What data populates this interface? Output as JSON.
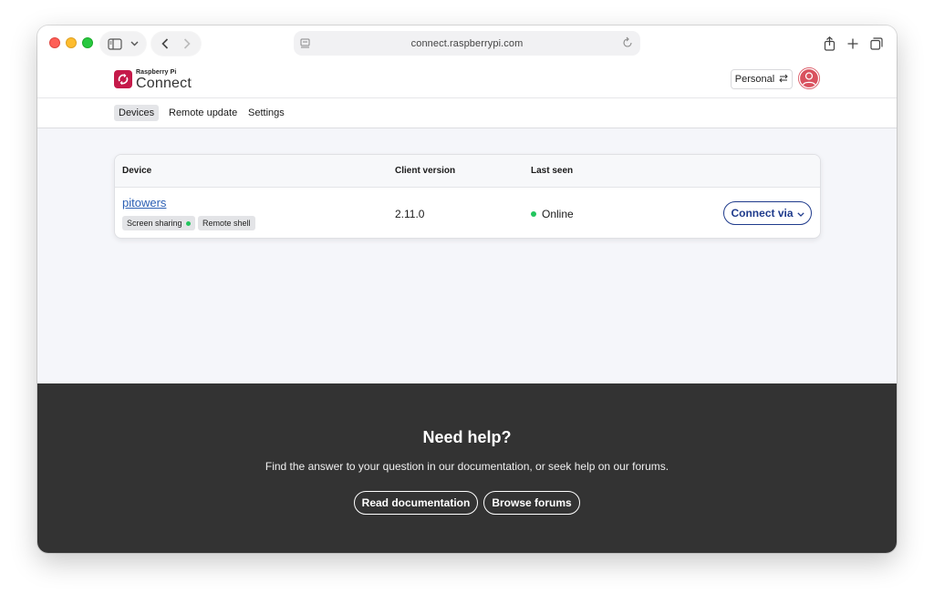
{
  "browser": {
    "url": "connect.raspberrypi.com",
    "icons": [
      "sidebar-icon",
      "chevron-down-icon",
      "back-icon",
      "forward-icon",
      "reader-icon",
      "reload-icon",
      "share-icon",
      "new-tab-icon",
      "tabs-overview-icon"
    ]
  },
  "header": {
    "brand_small": "Raspberry Pi",
    "brand_big": "Connect",
    "account_label": "Personal",
    "brand_color": "#c51a4a",
    "avatar_color": "#d9515e"
  },
  "nav": {
    "items": [
      {
        "label": "Devices",
        "active": true
      },
      {
        "label": "Remote update",
        "active": false
      },
      {
        "label": "Settings",
        "active": false
      }
    ]
  },
  "table": {
    "columns": [
      "Device",
      "Client version",
      "Last seen"
    ],
    "rows": [
      {
        "device": "pitowers",
        "tags": [
          "Screen sharing",
          "Remote shell"
        ],
        "client_version": "2.11.0",
        "last_seen": "Online",
        "action": "Connect via"
      }
    ],
    "status_color": "#22c55e",
    "action_color": "#1f3b8c"
  },
  "footer": {
    "title": "Need help?",
    "text": "Find the answer to your question in our documentation, or seek help on our forums.",
    "docs_button": "Read documentation",
    "forums_button": "Browse forums",
    "background": "#333333"
  }
}
